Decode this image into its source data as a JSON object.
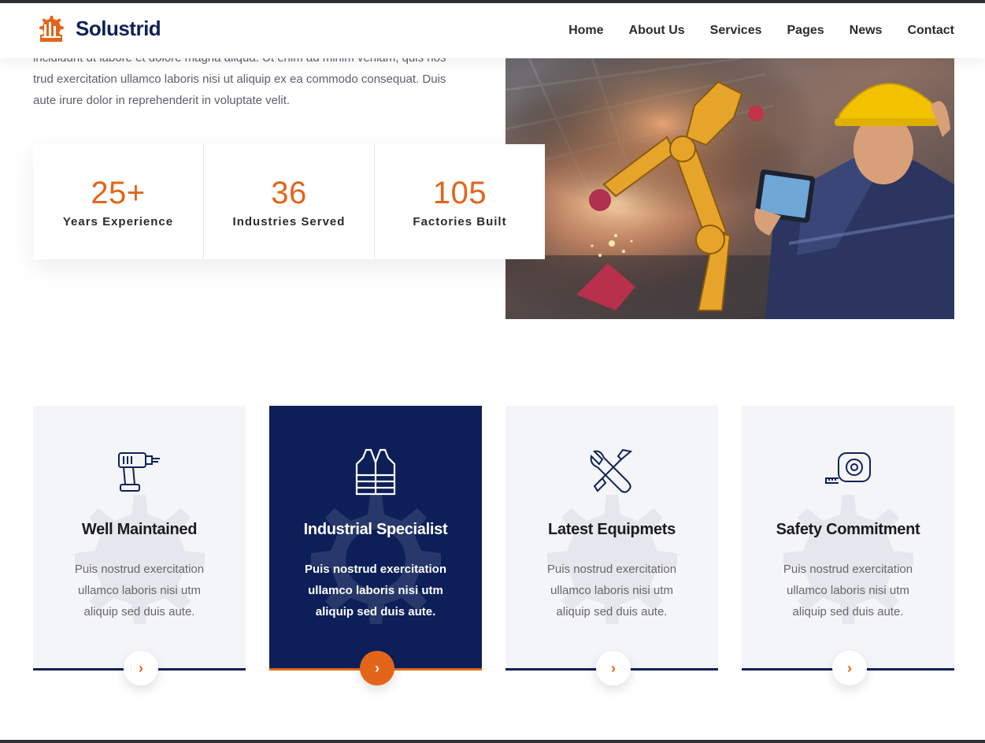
{
  "brand": {
    "name": "Solustrid",
    "accent": "#e2651a",
    "navy": "#0d1f58"
  },
  "nav": {
    "items": [
      {
        "label": "Home"
      },
      {
        "label": "About Us"
      },
      {
        "label": "Services"
      },
      {
        "label": "Pages"
      },
      {
        "label": "News"
      },
      {
        "label": "Contact"
      }
    ]
  },
  "intro": {
    "line1": "incididunt ut labore et dolore magna aliqua. Ut enim ad minim veniam, quis nos",
    "line2": "trud exercitation ullamco laboris nisi ut aliquip ex ea commodo consequat. Duis",
    "line3": "aute irure dolor in reprehenderit in voluptate velit."
  },
  "stats": [
    {
      "value": "25+",
      "label": "Years Experience"
    },
    {
      "value": "36",
      "label": "Industries Served"
    },
    {
      "value": "105",
      "label": "Factories Built"
    }
  ],
  "cards": [
    {
      "icon": "drill-icon",
      "title": "Well Maintained",
      "text": "Puis nostrud exercitation ullamco laboris nisi utm aliquip sed duis aute.",
      "button": "›"
    },
    {
      "icon": "safety-vest-icon",
      "title": "Industrial Specialist",
      "text": "Puis nostrud exercitation ullamco laboris nisi utm aliquip sed duis aute.",
      "button": "›"
    },
    {
      "icon": "wrench-screwdriver-icon",
      "title": "Latest Equipmets",
      "text": "Puis nostrud exercitation ullamco laboris nisi utm aliquip sed duis aute.",
      "button": "›"
    },
    {
      "icon": "tape-measure-icon",
      "title": "Safety Commitment",
      "text": "Puis nostrud exercitation ullamco laboris nisi utm aliquip sed duis aute.",
      "button": "›"
    }
  ]
}
